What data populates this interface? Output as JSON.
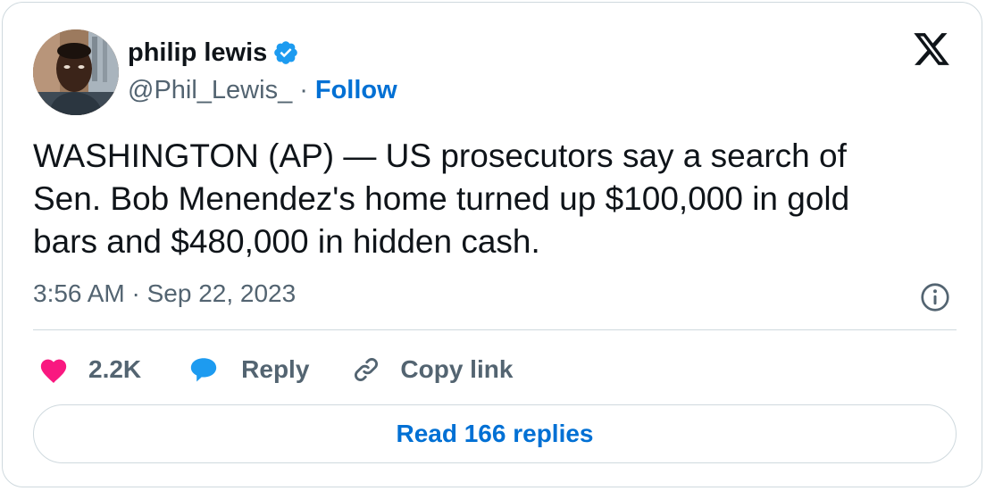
{
  "author": {
    "name": "philip lewis",
    "handle": "@Phil_Lewis_",
    "separator": "·",
    "follow_label": "Follow",
    "verified_icon": "verified-badge-icon",
    "verified_color": "#1d9bf0"
  },
  "brand": {
    "logo_icon": "x-logo-icon"
  },
  "tweet": {
    "text": "WASHINGTON (AP) — US prosecutors say a search of\nSen. Bob Menendez's home turned up $100,000 in gold\nbars and $480,000 in hidden cash.",
    "timestamp": "3:56 AM · Sep 22, 2023",
    "info_icon": "info-icon"
  },
  "actions": {
    "like_count": "2.2K",
    "like_icon": "heart-icon",
    "like_color": "#f91880",
    "reply_label": "Reply",
    "reply_icon": "speech-bubble-icon",
    "reply_color": "#1d9bf0",
    "copy_label": "Copy link",
    "copy_icon": "link-icon"
  },
  "footer": {
    "read_replies_label": "Read 166 replies"
  },
  "colors": {
    "text_primary": "#0f1419",
    "text_secondary": "#536471",
    "link": "#0070d4",
    "border": "#cfd9de"
  }
}
